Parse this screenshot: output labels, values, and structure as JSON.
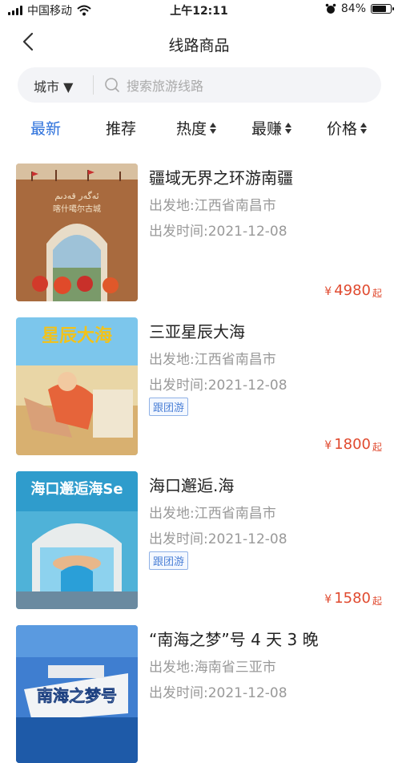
{
  "status_bar": {
    "carrier": "中国移动",
    "time": "上午12:11",
    "battery": "84%",
    "battery_level": 0.84
  },
  "nav": {
    "title": "线路商品"
  },
  "search": {
    "city_label": "城市 ▼",
    "placeholder": "搜索旅游线路"
  },
  "sort": [
    {
      "label": "最新"
    },
    {
      "label": "推荐"
    },
    {
      "label": "热度"
    },
    {
      "label": "最赚"
    },
    {
      "label": "价格"
    }
  ],
  "products": [
    {
      "title": "疆域无界之环游南疆",
      "origin": "出发地:江西省南昌市",
      "date": "出发时间:2021-12-08",
      "tag": "",
      "currency": "¥",
      "price": "4980",
      "suffix": "起"
    },
    {
      "title": "三亚星辰大海",
      "origin": "出发地:江西省南昌市",
      "date": "出发时间:2021-12-08",
      "tag": "跟团游",
      "currency": "¥",
      "price": "1800",
      "suffix": "起"
    },
    {
      "title": "海口邂逅.海",
      "origin": "出发地:江西省南昌市",
      "date": "出发时间:2021-12-08",
      "tag": "跟团游",
      "currency": "¥",
      "price": "1580",
      "suffix": "起"
    },
    {
      "title": "“南海之梦”号 4 天 3 晚",
      "origin": "出发地:海南省三亚市",
      "date": "出发时间:2021-12-08",
      "tag": "",
      "currency": "",
      "price": "",
      "suffix": ""
    }
  ],
  "thumb_text": {
    "p1_line1": "ﺋﻪﮔﻪﺭ ﻗﻪﺩﯨﻢ",
    "p1_line2": "喀什噶尔古城",
    "p2": "星辰大海",
    "p3": "海口邂逅海Se",
    "p4": "南海之梦号"
  }
}
